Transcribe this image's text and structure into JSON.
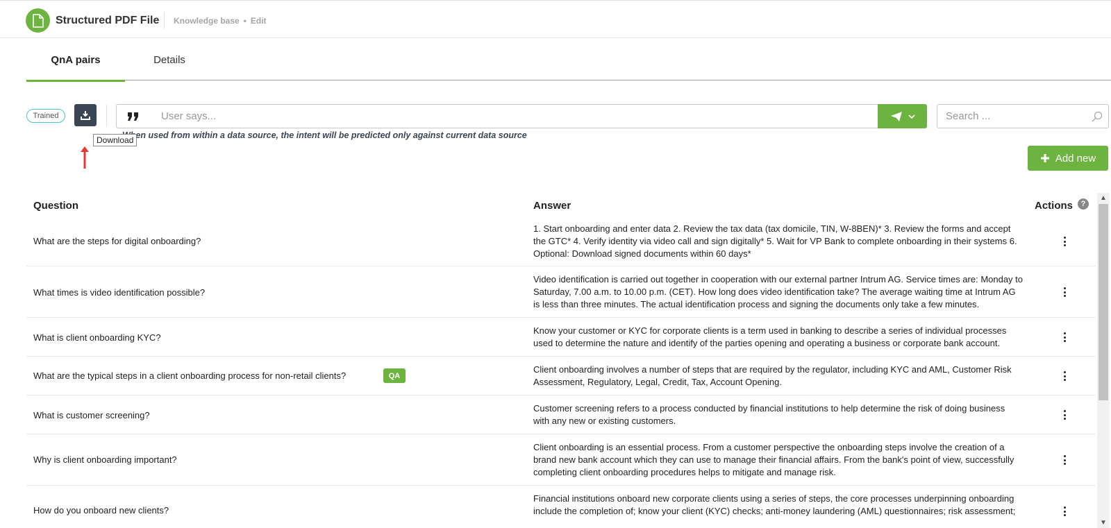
{
  "header": {
    "title": "Structured PDF File",
    "breadcrumb": [
      "Knowledge base",
      "Edit"
    ]
  },
  "tabs": [
    {
      "label": "QnA pairs",
      "active": true
    },
    {
      "label": "Details",
      "active": false
    }
  ],
  "toolbar": {
    "status_badge": "Trained",
    "download_tooltip": "Download",
    "user_says_placeholder": "User says...",
    "search_placeholder": "Search ...",
    "hint": "When used from within a data source, the intent will be predicted only against current data source",
    "add_new_label": "Add new"
  },
  "table": {
    "headers": {
      "question": "Question",
      "answer": "Answer",
      "actions": "Actions"
    },
    "rows": [
      {
        "question": "What are the steps for digital onboarding?",
        "answer": "1. Start onboarding and enter data 2. Review the tax data (tax domicile, TIN, W-8BEN)* 3. Review the forms and accept the GTC* 4. Verify identity via video call and sign digitally* 5. Wait for VP Bank to complete onboarding in their systems 6. Optional: Download signed documents within 60 days*",
        "badge": ""
      },
      {
        "question": "What times is video identification possible?",
        "answer": "Video identification is carried out together in cooperation with our external partner Intrum AG. Service times are: Monday to Saturday, 7.00 a.m. to 10.00 p.m. (CET). How long does video identification take? The average waiting time at Intrum AG is less than three minutes. The actual identification process and signing the documents only take a few minutes.",
        "badge": ""
      },
      {
        "question": "What is client onboarding KYC?",
        "answer": "Know your customer or KYC for corporate clients is a term used in banking to describe a series of individual processes used to determine the nature and identify of the parties opening and operating a business or corporate bank account.",
        "badge": ""
      },
      {
        "question": "What are the typical steps in a client onboarding process for non-retail clients?",
        "answer": "Client onboarding involves a number of steps that are required by the regulator, including KYC and AML, Customer Risk Assessment, Regulatory, Legal, Credit, Tax, Account Opening.",
        "badge": "QA"
      },
      {
        "question": "What is customer screening?",
        "answer": "Customer screening refers to a process conducted by financial institutions to help determine the risk of doing business with any new or existing customers.",
        "badge": ""
      },
      {
        "question": "Why is client onboarding important?",
        "answer": "Client onboarding is an essential process. From a customer perspective the onboarding steps involve the creation of a brand new bank account which they can use to manage their financial affairs. From the bank's point of view, successfully completing client onboarding procedures helps to mitigate and manage risk.",
        "badge": ""
      },
      {
        "question": "How do you onboard new clients?",
        "answer": "Financial institutions onboard new corporate clients using a series of steps, the core processes underpinning onboarding include the completion of; know your client (KYC) checks; anti-money laundering (AML) questionnaires; risk assessment;",
        "badge": ""
      }
    ]
  },
  "colors": {
    "accent": "#6db33f",
    "dark_button": "#3b4654",
    "badge_border": "#4fc3c8"
  }
}
